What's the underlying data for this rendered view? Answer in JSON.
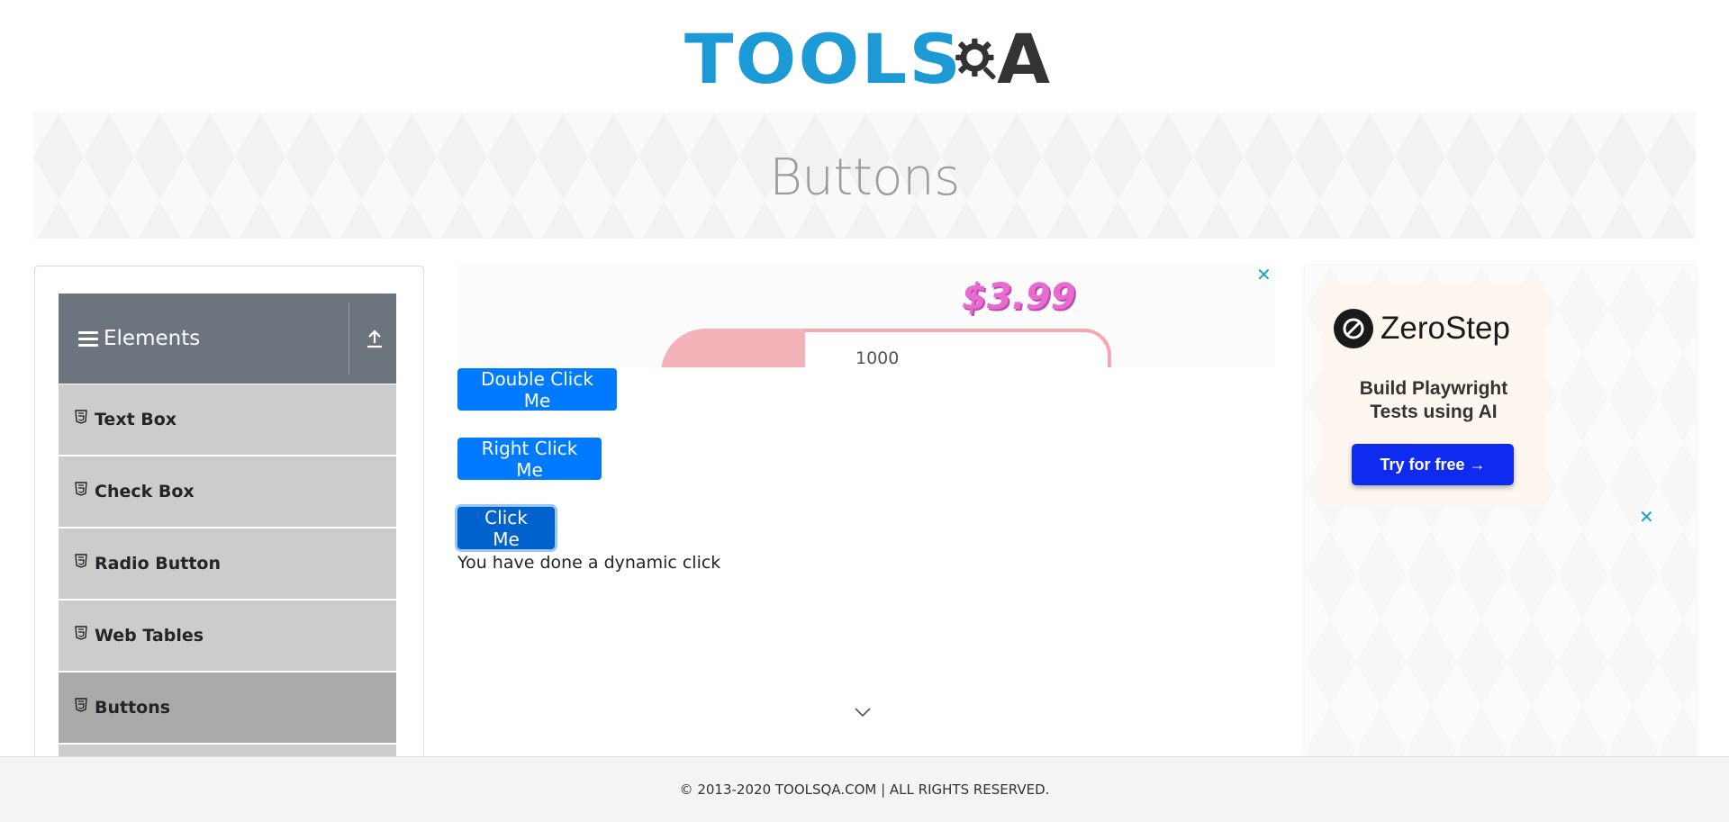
{
  "header": {
    "logo_text_main": "TOOLS",
    "logo_text_accent": "A",
    "logo_colors": {
      "main": "#1c9ad6",
      "accent": "#333333"
    }
  },
  "banner": {
    "title": "Buttons"
  },
  "sidebar": {
    "group_title": "Elements",
    "items": [
      {
        "label": "Text Box",
        "active": false
      },
      {
        "label": "Check Box",
        "active": false
      },
      {
        "label": "Radio Button",
        "active": false
      },
      {
        "label": "Web Tables",
        "active": false
      },
      {
        "label": "Buttons",
        "active": true
      }
    ]
  },
  "ad_top": {
    "price": "$3.99",
    "text": "1000"
  },
  "main": {
    "double_click_label": "Double Click Me",
    "right_click_label": "Right Click Me",
    "click_label": "Click Me",
    "dynamic_message": "You have done a dynamic click"
  },
  "right_ad": {
    "brand": "ZeroStep",
    "tagline_line1": "Build Playwright",
    "tagline_line2": "Tests using AI",
    "cta": "Try for free →"
  },
  "footer": {
    "text": "© 2013-2020 TOOLSQA.COM | ALL RIGHTS RESERVED."
  },
  "colors": {
    "primary_button": "#007bff",
    "sidebar_header": "#6c757d",
    "menu_item": "#cccccc",
    "menu_item_active": "#aaaaaa",
    "ad_close": "#1aa3c7",
    "cta": "#0f2bf0"
  },
  "icons": [
    "hamburger-icon",
    "collapse-arrow-icon",
    "html5-icon",
    "close-icon",
    "chevron-down-icon",
    "zerostep-logo-icon"
  ]
}
